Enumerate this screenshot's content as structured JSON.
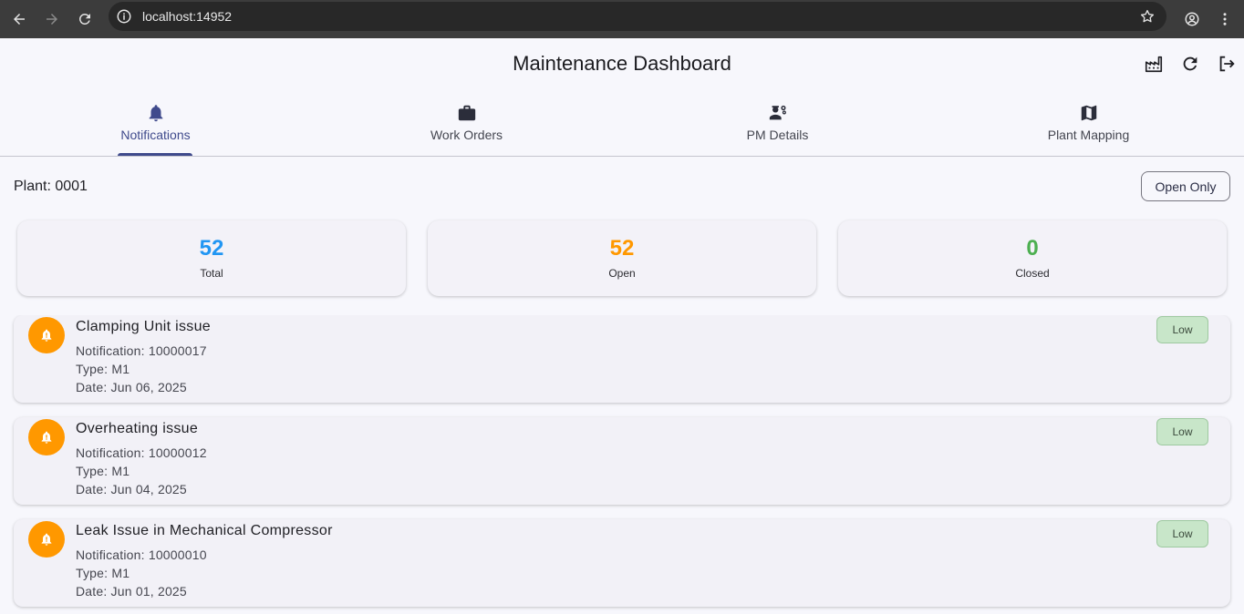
{
  "browser": {
    "url": "localhost:14952"
  },
  "app": {
    "title": "Maintenance Dashboard",
    "header_icons": [
      "factory-icon",
      "refresh-icon",
      "logout-icon"
    ]
  },
  "tabs": [
    {
      "label": "Notifications",
      "icon": "bell-icon",
      "active": true
    },
    {
      "label": "Work Orders",
      "icon": "briefcase-icon",
      "active": false
    },
    {
      "label": "PM Details",
      "icon": "engineering-icon",
      "active": false
    },
    {
      "label": "Plant Mapping",
      "icon": "map-icon",
      "active": false
    }
  ],
  "plant": {
    "label": "Plant: 0001",
    "filter_button": "Open Only"
  },
  "stats": [
    {
      "value": "52",
      "label": "Total",
      "color": "#2196f3"
    },
    {
      "value": "52",
      "label": "Open",
      "color": "#ff9800"
    },
    {
      "value": "0",
      "label": "Closed",
      "color": "#4caf50"
    }
  ],
  "notifications": [
    {
      "title": "Clamping Unit issue",
      "number": "Notification: 10000017",
      "type": "Type: M1",
      "date": "Date: Jun 06, 2025",
      "priority": "Low"
    },
    {
      "title": "Overheating issue",
      "number": "Notification: 10000012",
      "type": "Type: M1",
      "date": "Date: Jun 04, 2025",
      "priority": "Low"
    },
    {
      "title": "Leak Issue in Mechanical Compressor",
      "number": "Notification: 10000010",
      "type": "Type: M1",
      "date": "Date: Jun 01, 2025",
      "priority": "Low"
    }
  ],
  "colors": {
    "accent": "#3f4a8c",
    "avatar": "#ff9800",
    "priority_low_bg": "#c8e6c9"
  }
}
